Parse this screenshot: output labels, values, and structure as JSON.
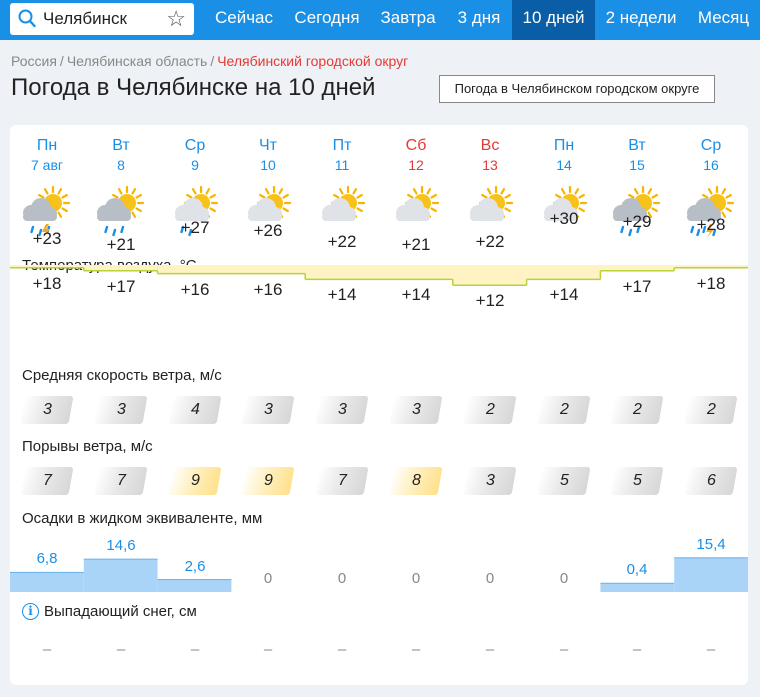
{
  "search": {
    "value": "Челябинск"
  },
  "nav": [
    "Сейчас",
    "Сегодня",
    "Завтра",
    "3 дня",
    "10 дней",
    "2 недели",
    "Месяц"
  ],
  "nav_active": 4,
  "breadcrumbs": [
    "Россия",
    "Челябинская область",
    "Челябинский городской округ"
  ],
  "title": "Погода в Челябинске на 10 дней",
  "alt_button": "Погода в Челябинском городском округе",
  "sections": {
    "temp": "Температура воздуха, °C",
    "wind": "Средняя скорость ветра, м/с",
    "gusts": "Порывы ветра, м/с",
    "precip": "Осадки в жидком эквиваленте, мм",
    "snow": "Выпадающий снег, см"
  },
  "days": [
    {
      "name": "Пн",
      "date": "7 авг",
      "weekend": false,
      "icon": "partly-cloudy-thunder-rain-icon",
      "tmax": "+23",
      "tmin": "+18",
      "wind": "3",
      "gust": "7",
      "precip": "6,8",
      "snow": "–"
    },
    {
      "name": "Вт",
      "date": "8",
      "weekend": false,
      "icon": "cloudy-rain-icon",
      "tmax": "+21",
      "tmin": "+17",
      "wind": "3",
      "gust": "7",
      "precip": "14,6",
      "snow": "–"
    },
    {
      "name": "Ср",
      "date": "9",
      "weekend": false,
      "icon": "partly-cloudy-rain-icon",
      "tmax": "+27",
      "tmin": "+16",
      "wind": "4",
      "gust": "9",
      "precip": "2,6",
      "snow": "–"
    },
    {
      "name": "Чт",
      "date": "10",
      "weekend": false,
      "icon": "partly-cloudy-icon",
      "tmax": "+26",
      "tmin": "+16",
      "wind": "3",
      "gust": "9",
      "precip": "0",
      "snow": "–"
    },
    {
      "name": "Пт",
      "date": "11",
      "weekend": false,
      "icon": "partly-cloudy-icon",
      "tmax": "+22",
      "tmin": "+14",
      "wind": "3",
      "gust": "7",
      "precip": "0",
      "snow": "–"
    },
    {
      "name": "Сб",
      "date": "12",
      "weekend": true,
      "icon": "partly-cloudy-icon",
      "tmax": "+21",
      "tmin": "+14",
      "wind": "3",
      "gust": "8",
      "precip": "0",
      "snow": "–"
    },
    {
      "name": "Вс",
      "date": "13",
      "weekend": true,
      "icon": "partly-cloudy-icon",
      "tmax": "+22",
      "tmin": "+12",
      "wind": "2",
      "gust": "3",
      "precip": "0",
      "snow": "–"
    },
    {
      "name": "Пн",
      "date": "14",
      "weekend": false,
      "icon": "partly-cloudy-icon",
      "tmax": "+30",
      "tmin": "+14",
      "wind": "2",
      "gust": "5",
      "precip": "0",
      "snow": "–"
    },
    {
      "name": "Вт",
      "date": "15",
      "weekend": false,
      "icon": "cloudy-rain-icon",
      "tmax": "+29",
      "tmin": "+17",
      "wind": "2",
      "gust": "5",
      "precip": "0,4",
      "snow": "–"
    },
    {
      "name": "Ср",
      "date": "16",
      "weekend": false,
      "icon": "partly-cloudy-thunder-heavy-rain-icon",
      "tmax": "+28",
      "tmin": "+18",
      "wind": "2",
      "gust": "6",
      "precip": "15,4",
      "snow": "–"
    }
  ],
  "colors": {
    "accent": "#1a8fe6",
    "nav_active": "#0a5ea8",
    "weekend": "#e53935",
    "precip_fill": "#a9d4f7",
    "temp_line": "#f5a623"
  }
}
